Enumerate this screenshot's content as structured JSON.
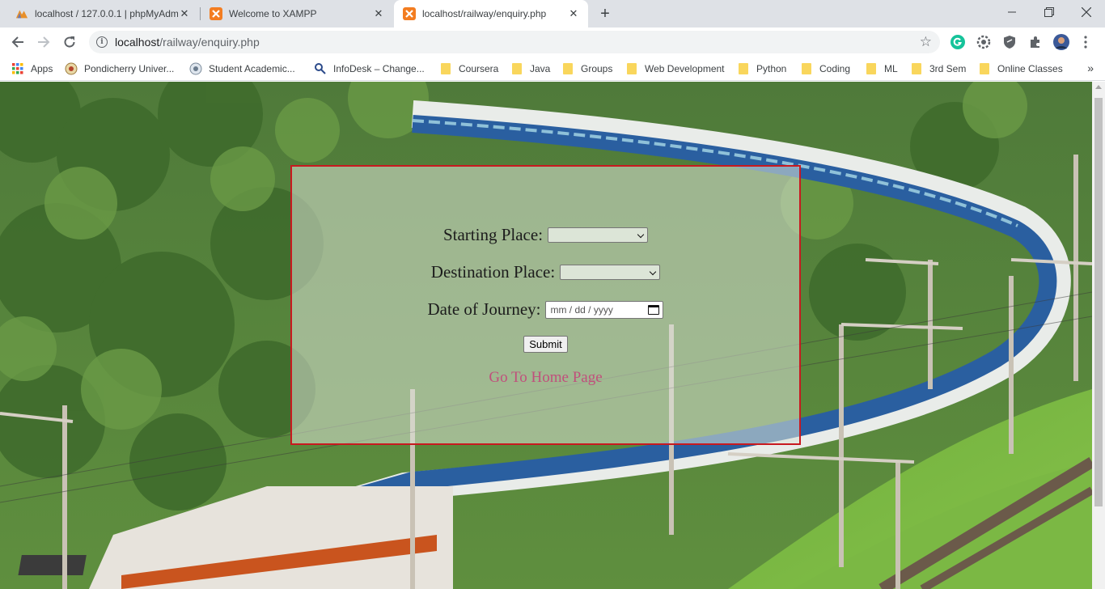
{
  "browser": {
    "tabs": [
      {
        "title": "localhost / 127.0.0.1 | phpMyAdm",
        "favicon": "phpmyadmin-icon",
        "active": false
      },
      {
        "title": "Welcome to XAMPP",
        "favicon": "xampp-icon",
        "active": false
      },
      {
        "title": "localhost/railway/enquiry.php",
        "favicon": "xampp-icon",
        "active": true
      }
    ],
    "new_tab": "+",
    "url_host": "localhost",
    "url_path": "/railway/enquiry.php",
    "bookmarks": [
      {
        "label": "Apps",
        "icon": "apps-grid-icon"
      },
      {
        "label": "Pondicherry Univer...",
        "icon": "site-icon"
      },
      {
        "label": "Student Academic...",
        "icon": "site-icon"
      },
      {
        "label": "InfoDesk – Change...",
        "icon": "site-icon"
      },
      {
        "label": "Coursera",
        "icon": "folder-icon"
      },
      {
        "label": "Java",
        "icon": "folder-icon"
      },
      {
        "label": "Groups",
        "icon": "folder-icon"
      },
      {
        "label": "Web Development",
        "icon": "folder-icon"
      },
      {
        "label": "Python",
        "icon": "folder-icon"
      },
      {
        "label": "Coding",
        "icon": "folder-icon"
      },
      {
        "label": "ML",
        "icon": "folder-icon"
      },
      {
        "label": "3rd Sem",
        "icon": "folder-icon"
      },
      {
        "label": "Online Classes",
        "icon": "folder-icon"
      }
    ],
    "bookmarks_overflow": "»"
  },
  "form": {
    "starting_label": "Starting Place:",
    "starting_value": "",
    "destination_label": "Destination Place:",
    "destination_value": "",
    "date_label": "Date of Journey:",
    "date_placeholder": "mm / dd / yyyy",
    "submit_label": "Submit",
    "home_link": "Go To Home Page"
  },
  "colors": {
    "panel_border": "#c8191f",
    "link": "#c0507c"
  }
}
